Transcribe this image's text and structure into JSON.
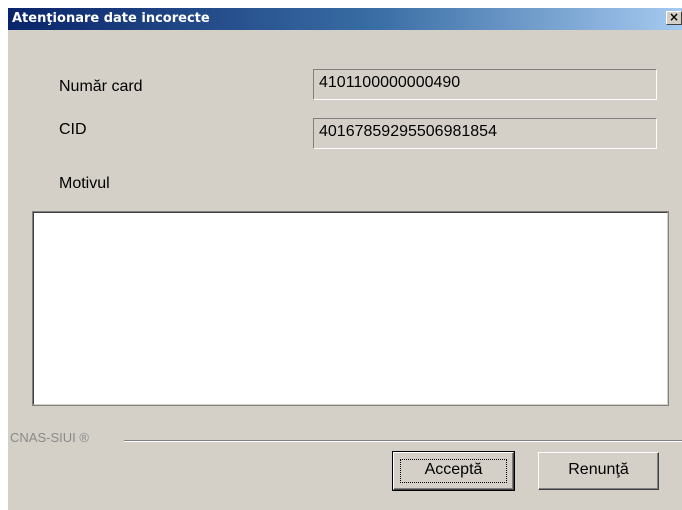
{
  "dialog": {
    "title": "Atenţionare date incorecte",
    "close_glyph": "×"
  },
  "fields": {
    "card_number": {
      "label": "Număr card",
      "value": "4101100000000490"
    },
    "cid": {
      "label": "CID",
      "value": "40167859295506981854"
    },
    "reason": {
      "label": "Motivul",
      "value": ""
    }
  },
  "footer": {
    "brand": "CNAS-SIUI ®"
  },
  "buttons": {
    "accept": "Acceptă",
    "cancel": "Renunţă"
  },
  "icons": {
    "close": "close-icon"
  },
  "colors": {
    "titlebar_start": "#0a246a",
    "titlebar_end": "#a6caf0",
    "dialog_bg": "#d4d0c8"
  }
}
